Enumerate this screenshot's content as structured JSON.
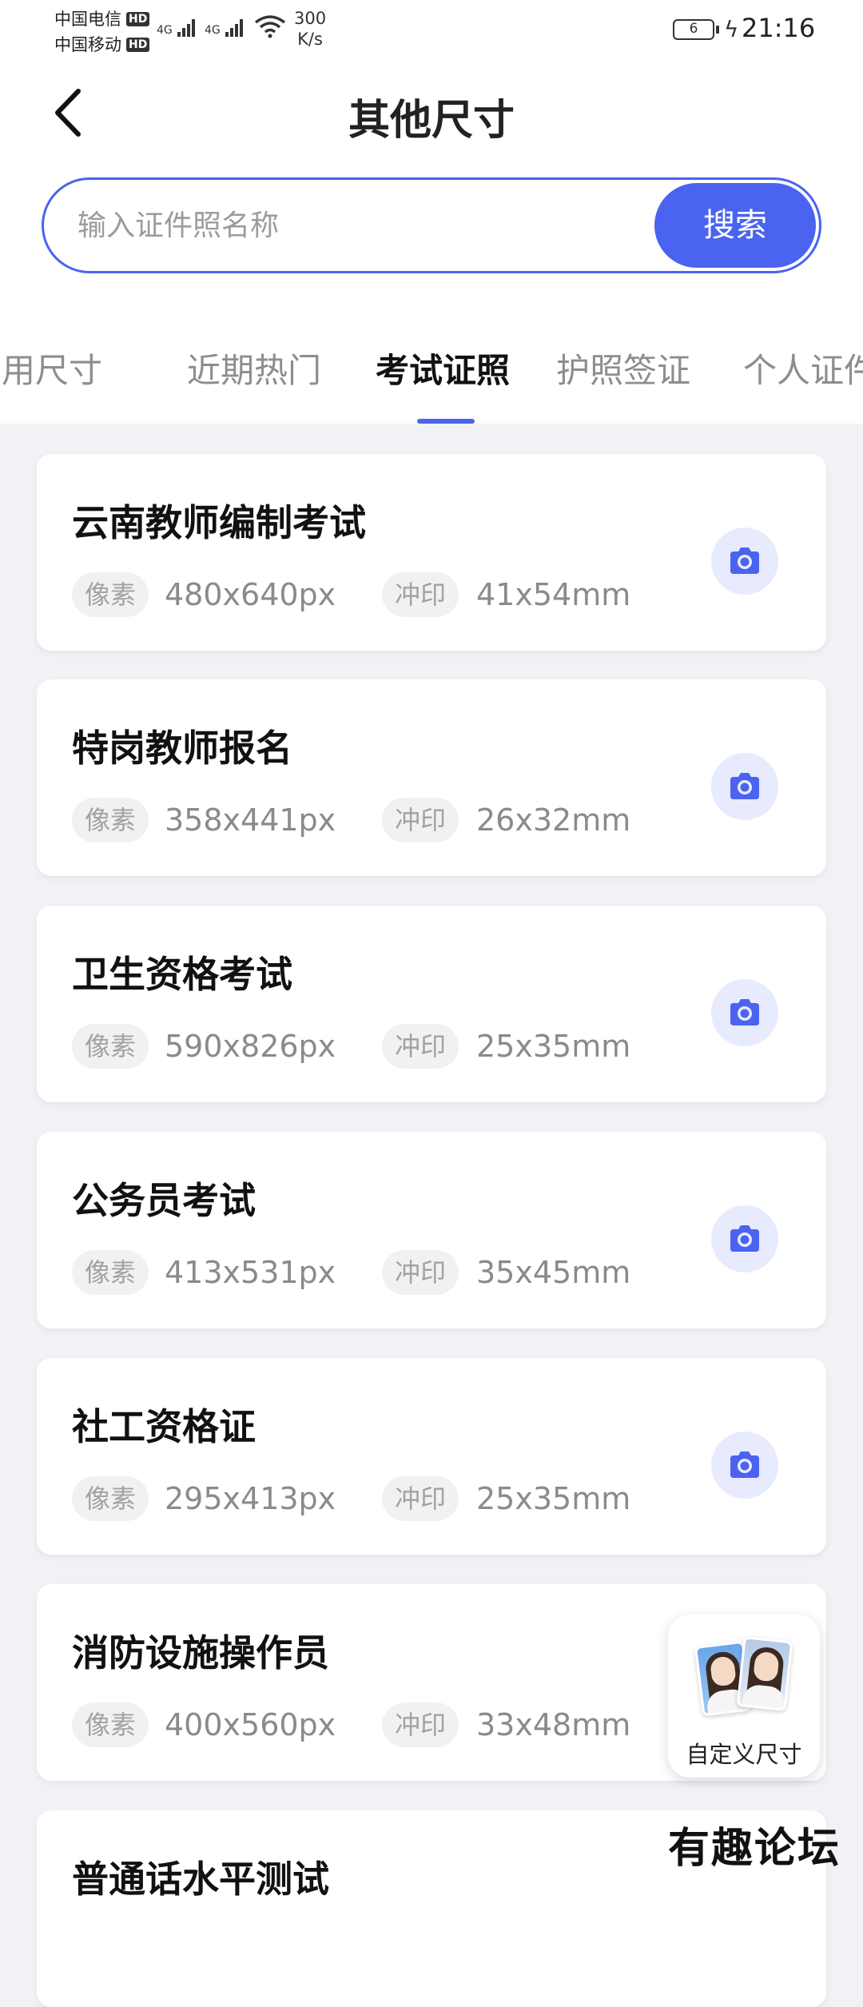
{
  "status_bar": {
    "carrier_1": "中国电信",
    "carrier_2": "中国移动",
    "hd_badge": "HD",
    "net_type": "4G",
    "net_speed_value": "300",
    "net_speed_unit": "K/s",
    "battery_level": "6",
    "time": "21:16"
  },
  "header": {
    "title": "其他尺寸",
    "back_icon": "chevron-left-icon"
  },
  "search": {
    "placeholder": "输入证件照名称",
    "value": "",
    "button_label": "搜索"
  },
  "tabs": [
    {
      "label": "常用尺寸",
      "active": false
    },
    {
      "label": "近期热门",
      "active": false
    },
    {
      "label": "考试证照",
      "active": true
    },
    {
      "label": "护照签证",
      "active": false
    },
    {
      "label": "个人证件",
      "active": false
    }
  ],
  "list_labels": {
    "pixel_tag": "像素",
    "print_tag": "冲印",
    "camera_icon": "camera-icon"
  },
  "items": [
    {
      "title": "云南教师编制考试",
      "pixels": "480x640px",
      "print": "41x54mm"
    },
    {
      "title": "特岗教师报名",
      "pixels": "358x441px",
      "print": "26x32mm"
    },
    {
      "title": "卫生资格考试",
      "pixels": "590x826px",
      "print": "25x35mm"
    },
    {
      "title": "公务员考试",
      "pixels": "413x531px",
      "print": "35x45mm"
    },
    {
      "title": "社工资格证",
      "pixels": "295x413px",
      "print": "25x35mm"
    },
    {
      "title": "消防设施操作员",
      "pixels": "400x560px",
      "print": "33x48mm"
    },
    {
      "title": "普通话水平测试",
      "pixels": "",
      "print": ""
    }
  ],
  "custom_size": {
    "label": "自定义尺寸"
  },
  "watermark": "有趣论坛",
  "colors": {
    "accent": "#4a63f0",
    "accent_light": "#e7ebfd",
    "page_bg": "#f1f2f6"
  }
}
